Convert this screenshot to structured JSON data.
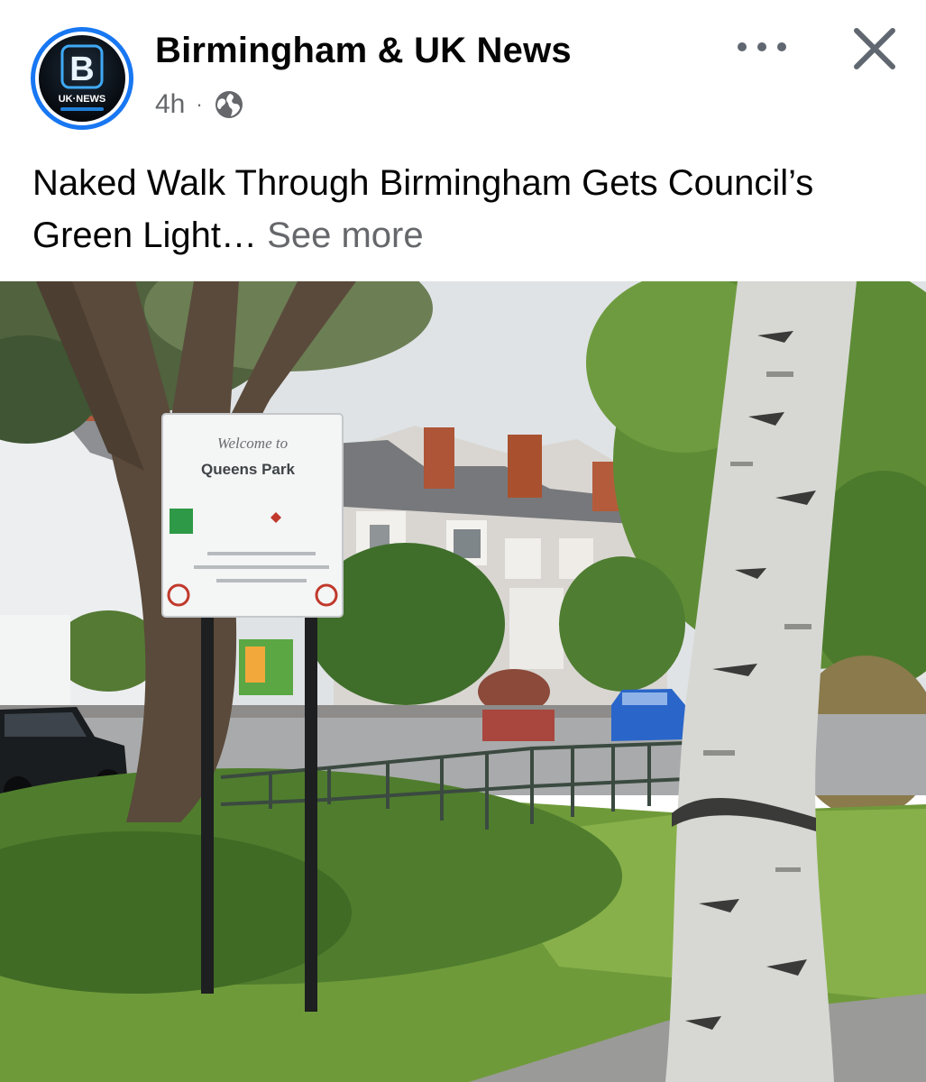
{
  "post": {
    "page_name": "Birmingham & UK News",
    "time": "4h",
    "separator": "·",
    "audience_icon": "globe-icon",
    "text": "Naked Walk Through Birmingham Gets Council’s Green Light…",
    "see_more": "See more"
  },
  "avatar": {
    "letter": "B",
    "caption": "UK·NEWS"
  },
  "actions": {
    "more_icon": "more-dots-icon",
    "close_icon": "close-icon"
  },
  "photo_sign": {
    "line1": "Welcome to",
    "line2": "Queens Park"
  },
  "colors": {
    "accent": "#1877f2",
    "meta_text": "#65676b",
    "body_text": "#050505"
  }
}
